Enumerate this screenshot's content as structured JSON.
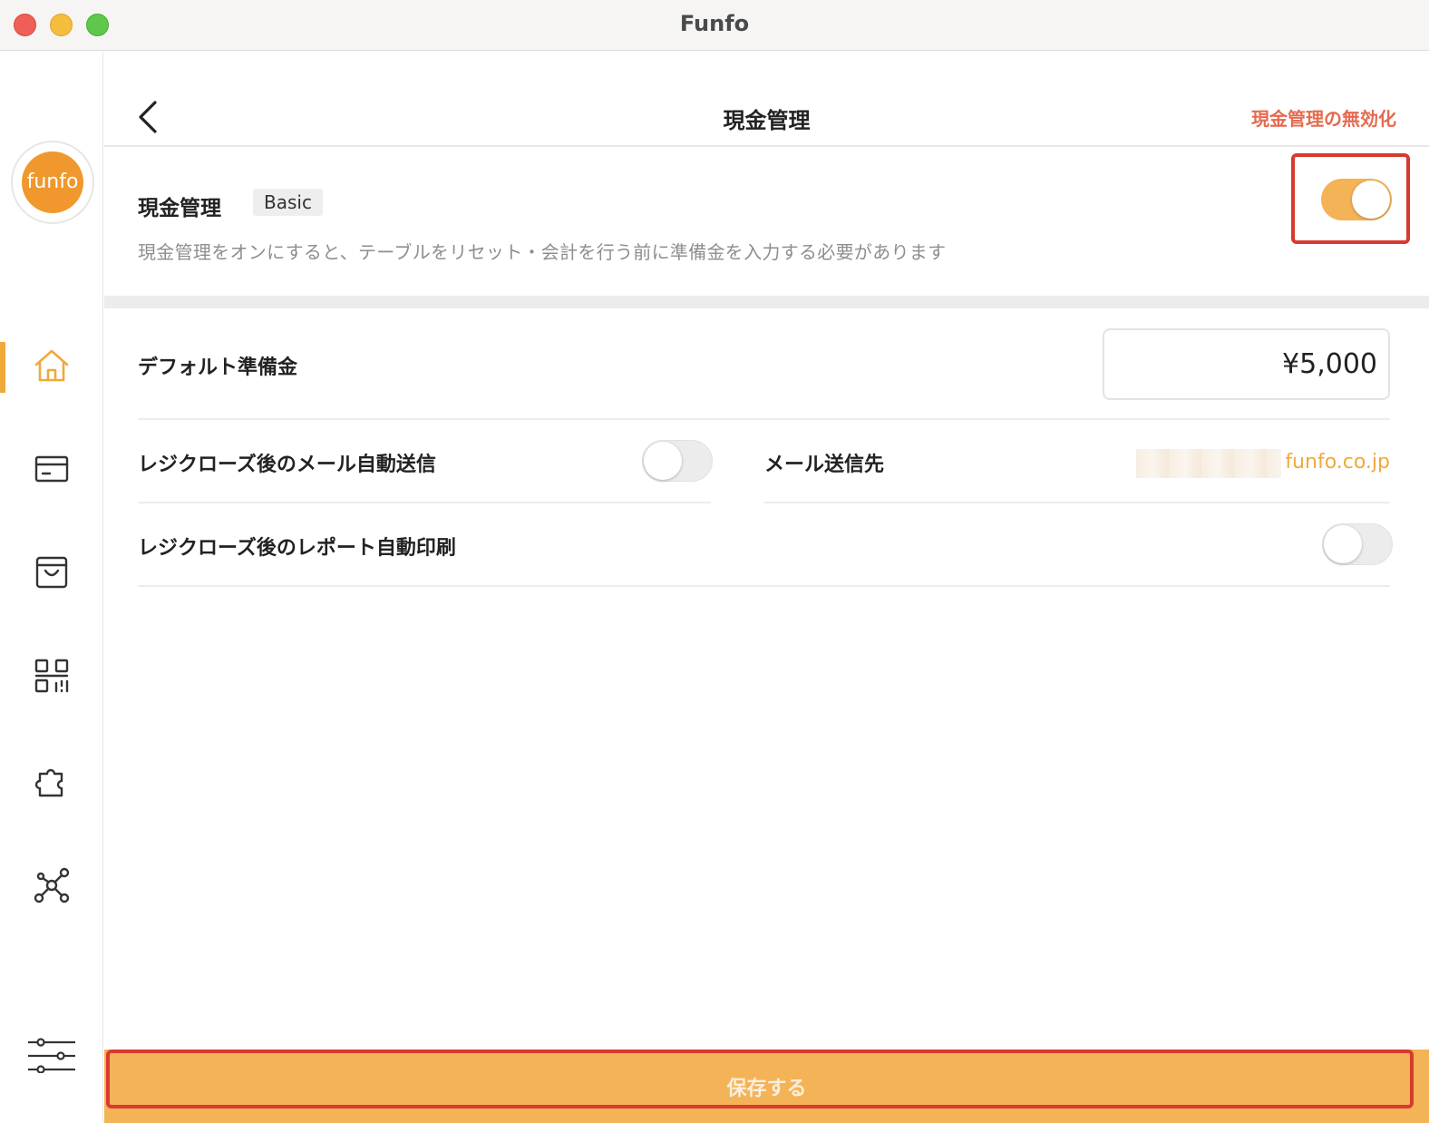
{
  "window": {
    "title": "Funfo"
  },
  "sidebar": {
    "logo_text": "funfo",
    "items": [
      {
        "icon": "home-icon",
        "active": true
      },
      {
        "icon": "card-icon",
        "active": false
      },
      {
        "icon": "shopping-bag-icon",
        "active": false
      },
      {
        "icon": "qr-code-icon",
        "active": false
      },
      {
        "icon": "puzzle-icon",
        "active": false
      },
      {
        "icon": "network-icon",
        "active": false
      },
      {
        "icon": "sliders-icon",
        "active": false
      }
    ]
  },
  "header": {
    "title": "現金管理",
    "disable_link": "現金管理の無効化"
  },
  "cash_management": {
    "title": "現金管理",
    "badge": "Basic",
    "description": "現金管理をオンにすると、テーブルをリセット・会計を行う前に準備金を入力する必要があります",
    "enabled": true
  },
  "settings": {
    "default_reserve_label": "デフォルト準備金",
    "default_reserve_value": "¥5,000",
    "auto_email_label": "レジクローズ後のメール自動送信",
    "auto_email_enabled": false,
    "email_dest_label": "メール送信先",
    "email_dest_value": "funfo.co.jp",
    "auto_print_label": "レジクローズ後のレポート自動印刷",
    "auto_print_enabled": false
  },
  "footer": {
    "save_label": "保存する"
  },
  "colors": {
    "accent": "#f3b356",
    "danger_link": "#e56a4f",
    "highlight": "#d93a2e"
  }
}
